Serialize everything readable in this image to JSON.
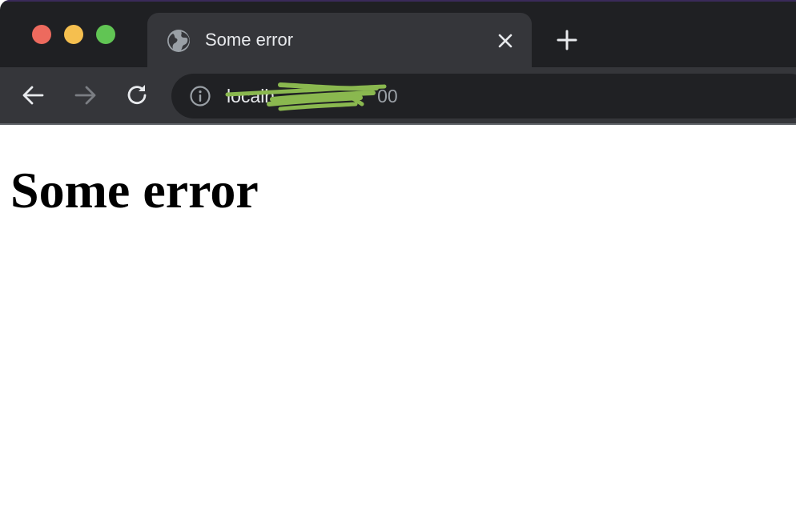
{
  "colors": {
    "tabstrip_bg": "#1f2023",
    "tab_active_bg": "#35363a",
    "toolbar_bg": "#35363a",
    "omnibox_bg": "#202124",
    "traffic_red": "#ed6a5e",
    "traffic_yellow": "#f5bf4f",
    "traffic_green": "#61c554",
    "redaction_green": "#8ab84f",
    "page_bg": "#ffffff",
    "heading_text": "#000000"
  },
  "window_controls": {
    "close_icon": "traffic-light-close",
    "minimize_icon": "traffic-light-minimize",
    "zoom_icon": "traffic-light-zoom"
  },
  "tab": {
    "favicon": "globe-icon",
    "title": "Some error",
    "close_icon": "close-icon"
  },
  "new_tab_icon": "plus-icon",
  "toolbar": {
    "back_icon": "arrow-left-icon",
    "forward_icon": "arrow-right-icon",
    "reload_icon": "reload-icon",
    "site_info_icon": "info-icon"
  },
  "omnibox": {
    "url_host": "localh",
    "url_port": "00"
  },
  "page": {
    "heading": "Some error"
  }
}
